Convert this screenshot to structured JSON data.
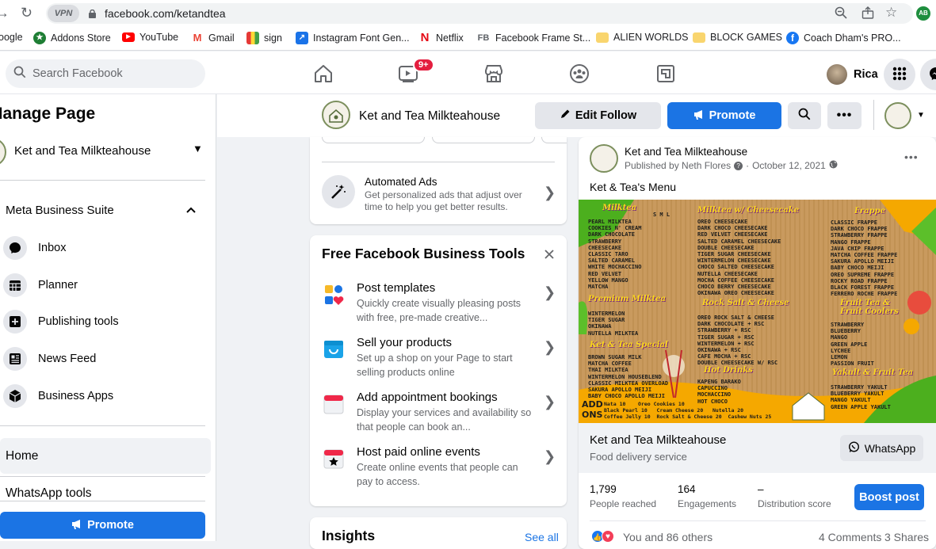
{
  "browser": {
    "vpn_label": "VPN",
    "url": "facebook.com/ketandtea",
    "profile_initials": "AB",
    "bookmarks": [
      {
        "label": "oogle",
        "icon": "google-icon"
      },
      {
        "label": "Addons Store",
        "icon": "addons-icon"
      },
      {
        "label": "YouTube",
        "icon": "youtube-icon"
      },
      {
        "label": "Gmail",
        "icon": "gmail-icon"
      },
      {
        "label": "sign",
        "icon": "sign-icon"
      },
      {
        "label": "Instagram Font Gen...",
        "icon": "instagram-font-icon"
      },
      {
        "label": "Netflix",
        "icon": "netflix-icon"
      },
      {
        "label": "Facebook Frame St...",
        "icon": "fb-frame-icon"
      },
      {
        "label": "ALIEN WORLDS",
        "icon": "folder-icon"
      },
      {
        "label": "BLOCK GAMES",
        "icon": "folder-icon"
      },
      {
        "label": "Coach Dham's PRO...",
        "icon": "facebook-icon"
      }
    ]
  },
  "topbar": {
    "search_placeholder": "Search Facebook",
    "notification_badge": "9+",
    "profile_name": "Rica"
  },
  "sidebar": {
    "title": "Manage Page",
    "page_name": "Ket and Tea Milkteahouse",
    "section_title": "Meta Business Suite",
    "items": [
      {
        "label": "Inbox"
      },
      {
        "label": "Planner"
      },
      {
        "label": "Publishing tools"
      },
      {
        "label": "News Feed"
      },
      {
        "label": "Business Apps"
      }
    ],
    "home_label": "Home",
    "whatsapp_label": "WhatsApp tools",
    "promote_label": "Promote"
  },
  "page_header": {
    "name": "Ket and Tea Milkteahouse",
    "edit_follow_label": "Edit Follow",
    "promote_label": "Promote"
  },
  "automated_ads": {
    "title": "Automated Ads",
    "description": "Get personalized ads that adjust over time to help you get better results."
  },
  "tools": {
    "title": "Free Facebook Business Tools",
    "items": [
      {
        "title": "Post templates",
        "description": "Quickly create visually pleasing posts with free, pre-made creative..."
      },
      {
        "title": "Sell your products",
        "description": "Set up a shop on your Page to start selling products online"
      },
      {
        "title": "Add appointment bookings",
        "description": "Display your services and availability so that people can book an..."
      },
      {
        "title": "Host paid online events",
        "description": "Create online events that people can pay to access."
      }
    ]
  },
  "insights": {
    "title": "Insights",
    "see_all": "See all"
  },
  "post": {
    "page_name": "Ket and Tea Milkteahouse",
    "published_by": "Published by Neth Flores",
    "date": "October 12, 2021",
    "text": "Ket & Tea's Menu",
    "link_title": "Ket and Tea Milkteahouse",
    "link_subtitle": "Food delivery service",
    "whatsapp_label": "WhatsApp",
    "stats": [
      {
        "value": "1,799",
        "label": "People reached"
      },
      {
        "value": "164",
        "label": "Engagements"
      },
      {
        "value": "–",
        "label": "Distribution score"
      }
    ],
    "boost_label": "Boost post",
    "reactions": "You and 86 others",
    "comments": "4 Comments",
    "shares": "3 Shares"
  },
  "menu_image": {
    "headings": [
      "Milktea",
      "Milktea w/ Cheesecake",
      "Frappe",
      "Premium Milktea",
      "Rock Salt & Cheese",
      "Fruit Tea & Fruit Coolers",
      "Ket & Tea Special",
      "Hot Drinks",
      "Yakult & Fruit Tea"
    ],
    "size_labels": "S M L",
    "col1": "PEARL MILKTEA\nCOOKIES N' CREAM\nDARK CHOCOLATE\nSTRAWBERRY\nCHEESECAKE\nCLASSIC TARO\nSALTED CARAMEL\nWHITE MOCHACCINO\nRED VELVET\nYELLOW MANGO\nMATCHA",
    "col1b": "WINTERMELON\nTIGER SUGAR\nOKINAWA\nNUTELLA MILKTEA",
    "col1c": "BROWN SUGAR MILK\nMATCHA COFFEE\nTHAI MILKTEA\nWINTERMELON HOUSEBLEND\nCLASSIC MILKTEA OVERLOAD\nSAKURA APOLLO MEIJI\nBABY CHOCO APOLLO MEIJI",
    "col2": "OREO CHEESECAKE\nDARK CHOCO CHEESECAKE\nRED VELVET CHEESECAKE\nSALTED CARAMEL CHEESECAKE\nDOUBLE CHEESECAKE\nTIGER SUGAR CHEESECAKE\nWINTERMELON CHEESECAKE\nCHOCO SALTED CHEESECAKE\nNUTELLA CHEESECAKE\nMOCHA COFFEE CHEESECAKE\nCHOCO BERRY CHEESECAKE\nOKINAWA OREO CHEESECAKE",
    "col2b": "OREO ROCK SALT & CHEESE\nDARK CHOCOLATE + RSC\nSTRAWBERRY + RSC\nTIGER SUGAR + RSC\nWINTERMELON + RSC\nOKINAWA + RSC\nCAFE MOCHA + RSC\nDOUBLE CHEESECAKE W/ RSC",
    "col2c": "KAPENG BARAKO\nCAPUCCINO\nMOCHACCINO\nHOT CHOCO",
    "col3": "CLASSIC FRAPPE\nDARK CHOCO FRAPPE\nSTRAWBERRY FRAPPE\nMANGO FRAPPE\nJAVA CHIP FRAPPE\nMATCHA COFFEE FRAPPE\nSAKURA APOLLO MEIJI\nBABY CHOCO MEIJI\nOREO SUPREME FRAPPE\nROCKY ROAD FRAPPE\nBLACK FOREST FRAPPE\nFERRERO ROCHE FRAPPE",
    "col3b": "STRAWBERRY\nBLUEBERRY\nMANGO\nGREEN APPLE\nLYCHEE\nLEMON\nPASSION FRUIT",
    "col3c": "STRAWBERRY YAKULT\nBLUEBERRY YAKULT\nMANGO YAKULT\nGREEN APPLE YAKULT",
    "addons": "Nata 10    Oreo Cookies 10\nBlack Pearl 10   Cream Cheese 20   Nutella 20\nCoffee Jelly 10  Rock Salt & Cheese 20  Cashew Nuts 25"
  },
  "colors": {
    "brand_blue": "#1b74e4",
    "menu_yellow": "#f5a800",
    "menu_green": "#4caf1e"
  }
}
